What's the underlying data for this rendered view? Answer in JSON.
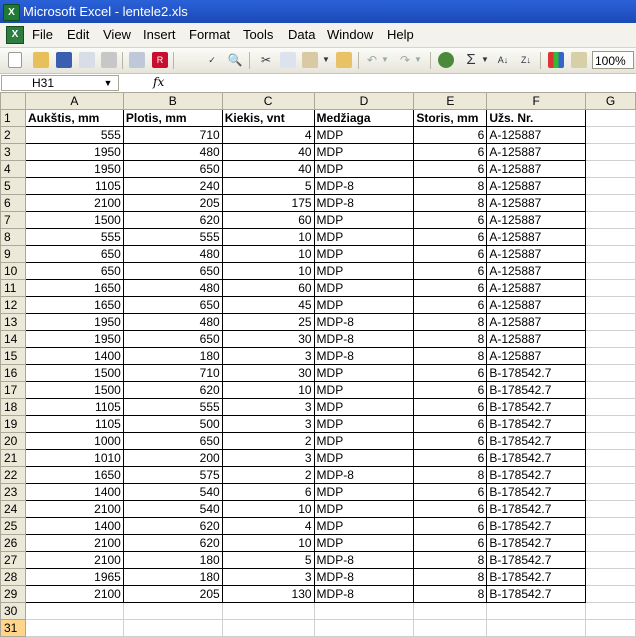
{
  "window": {
    "title": "Microsoft Excel - lentele2.xls"
  },
  "menu": [
    "File",
    "Edit",
    "View",
    "Insert",
    "Format",
    "Tools",
    "Data",
    "Window",
    "Help"
  ],
  "toolbar": {
    "zoom": "100%"
  },
  "formula_bar": {
    "name_box": "H31",
    "fx_label": "fx",
    "formula": ""
  },
  "columns": [
    "A",
    "B",
    "C",
    "D",
    "E",
    "F",
    "G"
  ],
  "header_row": [
    "Aukštis, mm",
    "Plotis, mm",
    "Kiekis, vnt",
    "Medžiaga",
    "Storis, mm",
    "Užs. Nr."
  ],
  "rows": [
    [
      555,
      710,
      4,
      "MDP",
      6,
      "A-125887"
    ],
    [
      1950,
      480,
      40,
      "MDP",
      6,
      "A-125887"
    ],
    [
      1950,
      650,
      40,
      "MDP",
      6,
      "A-125887"
    ],
    [
      1105,
      240,
      5,
      "MDP-8",
      8,
      "A-125887"
    ],
    [
      2100,
      205,
      175,
      "MDP-8",
      8,
      "A-125887"
    ],
    [
      1500,
      620,
      60,
      "MDP",
      6,
      "A-125887"
    ],
    [
      555,
      555,
      10,
      "MDP",
      6,
      "A-125887"
    ],
    [
      650,
      480,
      10,
      "MDP",
      6,
      "A-125887"
    ],
    [
      650,
      650,
      10,
      "MDP",
      6,
      "A-125887"
    ],
    [
      1650,
      480,
      60,
      "MDP",
      6,
      "A-125887"
    ],
    [
      1650,
      650,
      45,
      "MDP",
      6,
      "A-125887"
    ],
    [
      1950,
      480,
      25,
      "MDP-8",
      8,
      "A-125887"
    ],
    [
      1950,
      650,
      30,
      "MDP-8",
      8,
      "A-125887"
    ],
    [
      1400,
      180,
      3,
      "MDP-8",
      8,
      "A-125887"
    ],
    [
      1500,
      710,
      30,
      "MDP",
      6,
      "B-178542.7"
    ],
    [
      1500,
      620,
      10,
      "MDP",
      6,
      "B-178542.7"
    ],
    [
      1105,
      555,
      3,
      "MDP",
      6,
      "B-178542.7"
    ],
    [
      1105,
      500,
      3,
      "MDP",
      6,
      "B-178542.7"
    ],
    [
      1000,
      650,
      2,
      "MDP",
      6,
      "B-178542.7"
    ],
    [
      1010,
      200,
      3,
      "MDP",
      6,
      "B-178542.7"
    ],
    [
      1650,
      575,
      2,
      "MDP-8",
      8,
      "B-178542.7"
    ],
    [
      1400,
      540,
      6,
      "MDP",
      6,
      "B-178542.7"
    ],
    [
      2100,
      540,
      10,
      "MDP",
      6,
      "B-178542.7"
    ],
    [
      1400,
      620,
      4,
      "MDP",
      6,
      "B-178542.7"
    ],
    [
      2100,
      620,
      10,
      "MDP",
      6,
      "B-178542.7"
    ],
    [
      2100,
      180,
      5,
      "MDP-8",
      8,
      "B-178542.7"
    ],
    [
      1965,
      180,
      3,
      "MDP-8",
      8,
      "B-178542.7"
    ],
    [
      2100,
      205,
      130,
      "MDP-8",
      8,
      "B-178542.7"
    ]
  ],
  "extra_row_numbers": [
    "30",
    "31"
  ]
}
